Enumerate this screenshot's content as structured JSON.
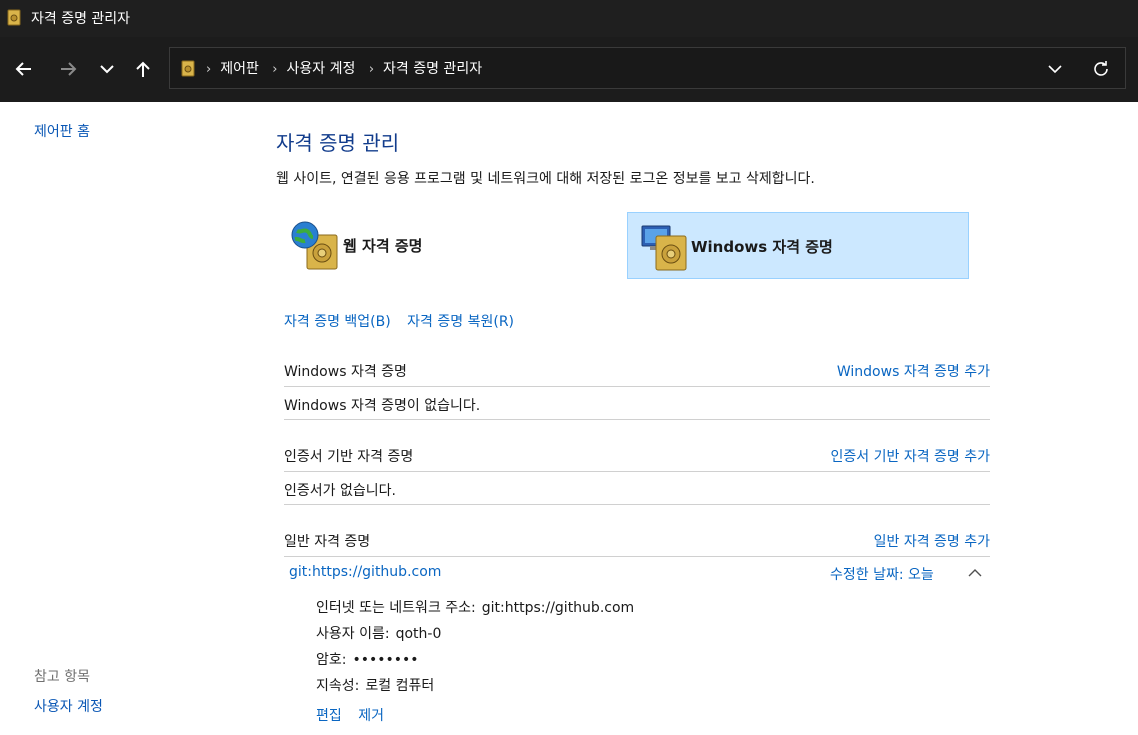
{
  "window": {
    "title": "자격 증명 관리자"
  },
  "nav": {
    "breadcrumb": [
      "제어판",
      "사용자 계정",
      "자격 증명 관리자"
    ]
  },
  "sidebar": {
    "home": "제어판 홈",
    "see_also_heading": "참고 항목",
    "see_also_link": "사용자 계정"
  },
  "main": {
    "title": "자격 증명 관리",
    "description": "웹 사이트, 연결된 응용 프로그램 및 네트워크에 대해 저장된 로그온 정보를 보고 삭제합니다.",
    "web_credentials": "웹 자격 증명",
    "windows_credentials": "Windows 자격 증명",
    "backup": "자격 증명 백업(B)",
    "restore": "자격 증명 복원(R)"
  },
  "sections": {
    "windows": {
      "title": "Windows 자격 증명",
      "add": "Windows 자격 증명 추가",
      "empty": "Windows 자격 증명이 없습니다."
    },
    "certificate": {
      "title": "인증서 기반 자격 증명",
      "add": "인증서 기반 자격 증명 추가",
      "empty": "인증서가 없습니다."
    },
    "generic": {
      "title": "일반 자격 증명",
      "add": "일반 자격 증명 추가"
    }
  },
  "credential": {
    "name": "git:https://github.com",
    "modified_label": "수정한 날짜:",
    "modified_value": "오늘",
    "address_label": "인터넷 또는 네트워크 주소:",
    "address_value": "git:https://github.com",
    "username_label": "사용자 이름:",
    "username_value": "qoth-0",
    "password_label": "암호:",
    "password_value": "••••••••",
    "persistence_label": "지속성:",
    "persistence_value": "로컬 컴퓨터",
    "edit": "편집",
    "remove": "제거"
  },
  "colors": {
    "link": "#0a66c2",
    "title": "#123c8c",
    "selected_bg": "#cce8ff",
    "titlebar_bg": "#1f1f1f"
  }
}
